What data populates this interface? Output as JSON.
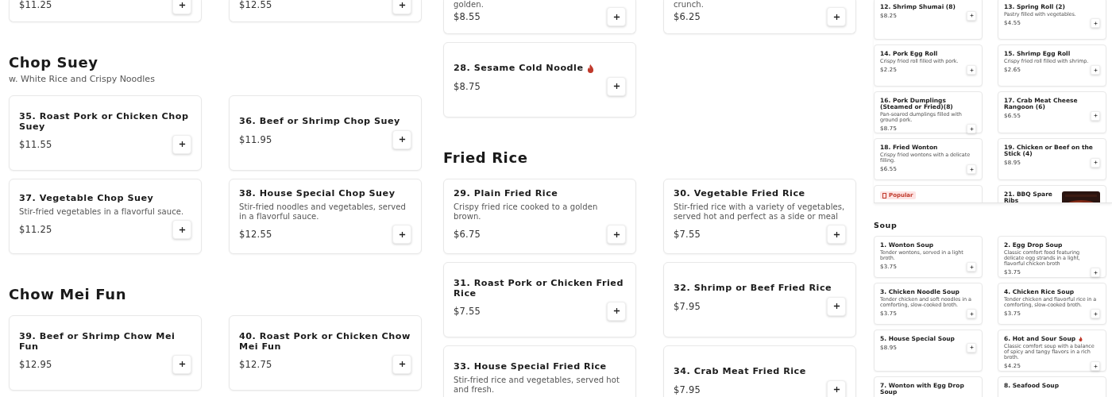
{
  "menu_columns": [
    {
      "sections": [
        {
          "items": [
            {
              "price": "$11.25"
            },
            {
              "price": "$12.55"
            }
          ]
        },
        {
          "heading": "Chop Suey",
          "subtitle": "w. White Rice and Crispy Noodles",
          "items": [
            {
              "title": "35. Roast Pork or Chicken Chop Suey",
              "price": "$11.55",
              "spicy": false
            },
            {
              "title": "36. Beef or Shrimp Chop Suey",
              "price": "$11.95",
              "spicy": false
            },
            {
              "title": "37. Vegetable Chop Suey",
              "desc": "Stir-fried vegetables in a flavorful sauce.",
              "price": "$11.25",
              "spicy": false
            },
            {
              "title": "38. House Special Chop Suey",
              "desc": "Stir-fried noodles and vegetables, served in a flavorful sauce.",
              "price": "$12.55",
              "spicy": false
            }
          ]
        },
        {
          "heading": "Chow Mei Fun",
          "items": [
            {
              "title": "39. Beef or Shrimp Chow Mei Fun",
              "price": "$12.95",
              "spicy": false
            },
            {
              "title": "40. Roast Pork or Chicken Chow Mei Fun",
              "price": "$12.75",
              "spicy": false
            }
          ]
        }
      ]
    },
    {
      "sections": [
        {
          "items": [
            {
              "desc": "golden.",
              "price": "$8.55"
            },
            {
              "desc": "crunch.",
              "price": "$6.25"
            },
            {
              "title": "28. Sesame Cold Noodle",
              "price": "$8.75",
              "spicy": true
            }
          ]
        },
        {
          "heading": "Fried Rice",
          "items": [
            {
              "title": "29. Plain Fried Rice",
              "desc": "Crispy fried rice cooked to a golden brown.",
              "price": "$6.75",
              "spicy": false
            },
            {
              "title": "30. Vegetable Fried Rice",
              "desc": "Stir-fried rice with a variety of vegetables, served hot and perfect as a side or meal",
              "price": "$7.55",
              "spicy": false
            },
            {
              "title": "31. Roast Pork or Chicken Fried Rice",
              "price": "$7.55",
              "spicy": false
            },
            {
              "title": "32. Shrimp or Beef Fried Rice",
              "price": "$7.95",
              "spicy": false
            },
            {
              "title": "33. House Special Fried Rice",
              "desc": "Stir-fried rice and vegetables, served hot and fresh.",
              "spicy": false
            },
            {
              "title": "34. Crab Meat Fried Rice",
              "price": "$7.95",
              "spicy": false
            }
          ]
        }
      ]
    }
  ],
  "preview": {
    "appetizers": [
      {
        "title": "12. Shrimp Shumai (8)",
        "price": "$8.25",
        "spicy": false
      },
      {
        "title": "13. Spring Roll (2)",
        "desc": "Pastry filled with vegetables.",
        "price": "$4.55",
        "spicy": false
      },
      {
        "title": "14. Pork Egg Roll",
        "desc": "Crispy fried roll filled with pork.",
        "price": "$2.25",
        "spicy": false
      },
      {
        "title": "15. Shrimp Egg Roll",
        "desc": "Crispy fried roll filled with shrimp.",
        "price": "$2.65",
        "spicy": false
      },
      {
        "title": "16. Pork Dumplings (Steamed or Fried)(8)",
        "desc": "Pan-seared dumplings filled with ground pork.",
        "price": "$8.75",
        "spicy": false
      },
      {
        "title": "17. Crab Meat Cheese Rangoon (6)",
        "price": "$6.55",
        "spicy": false
      },
      {
        "title": "18. Fried Wonton",
        "desc": "Crispy fried wontons with a delicate filling.",
        "price": "$6.55",
        "spicy": false
      },
      {
        "title": "19. Chicken or Beef on the Stick (4)",
        "price": "$8.95",
        "spicy": false
      },
      {
        "badge": "Popular"
      },
      {
        "title": "21. BBQ Spare Ribs",
        "spicy": false
      }
    ],
    "soup": {
      "heading": "Soup",
      "items": [
        {
          "title": "1. Wonton Soup",
          "desc": "Tender wontons, served in a light broth.",
          "price": "$3.75",
          "spicy": false
        },
        {
          "title": "2. Egg Drop Soup",
          "desc": "Classic comfort food featuring delicate egg strands in a light, flavorful chicken broth",
          "price": "$3.75",
          "spicy": false
        },
        {
          "title": "3. Chicken Noodle Soup",
          "desc": "Tender chicken and soft noodles in a comforting, slow-cooked broth.",
          "price": "$3.75",
          "spicy": false
        },
        {
          "title": "4. Chicken Rice Soup",
          "desc": "Tender chicken and flavorful rice in a comforting, slow-cooked broth.",
          "price": "$3.75",
          "spicy": false
        },
        {
          "title": "5. House Special Soup",
          "price": "$8.95",
          "spicy": false
        },
        {
          "title": "6. Hot and Sour Soup",
          "desc": "Classic comfort soup with a balance of spicy and tangy flavors in a rich broth.",
          "price": "$4.25",
          "spicy": true
        },
        {
          "title": "7. Wonton with Egg Drop Soup",
          "spicy": false
        },
        {
          "title": "8. Seafood Soup",
          "spicy": false
        }
      ]
    }
  }
}
